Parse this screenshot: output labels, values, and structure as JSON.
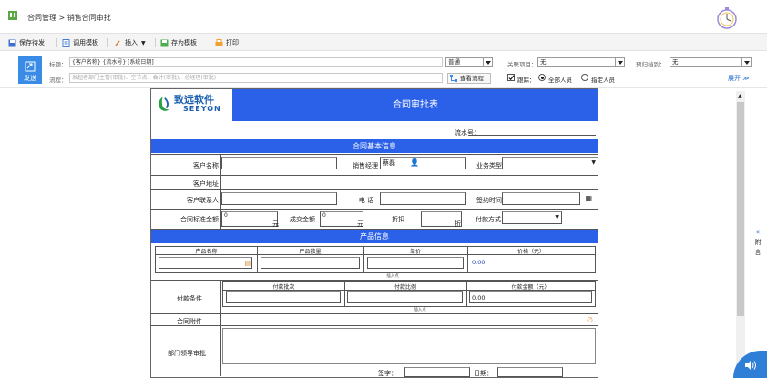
{
  "breadcrumb": "合同管理 > 销售合同审批",
  "toolbar": {
    "save_draft": "保存待发",
    "call_template": "调用模板",
    "insert": "插入",
    "save_as_template": "存为模板",
    "print": "打印"
  },
  "header": {
    "send_label": "发送",
    "subject_label": "标题：",
    "subject_value": "{客户名称} {流水号} [系统日期]",
    "importance_value": "普通",
    "related_project_label": "关联项目：",
    "related_project_value": "无",
    "archive_label": "预归档到：",
    "archive_value": "无",
    "flow_label": "流程：",
    "flow_placeholder": "发起者部门主管(审批)、空节点、会计(审批)、总经理(审批)",
    "view_flow": "查看流程",
    "trace_label": "跟踪：",
    "all_people": "全部人员",
    "specific_people": "指定人员",
    "expand": "展开"
  },
  "form": {
    "logo_cn": "致远软件",
    "logo_en": "SEEYON",
    "title": "合同审批表",
    "serial_label": "流水号：",
    "section_basic": "合同基本信息",
    "customer_name": "客户名称",
    "sales_manager": "销售经理",
    "sales_manager_value": "蔡磊",
    "business_type": "业务类型",
    "customer_address": "客户地址",
    "customer_contact": "客户联系人",
    "phone": "电 话",
    "sign_time": "签约时间",
    "standard_amount": "合同标准金额",
    "standard_amount_value": "0",
    "yuan1": "元",
    "deal_amount": "成交金额",
    "deal_amount_value": "0",
    "yuan2": "元",
    "discount": "折扣",
    "zhe": "折",
    "payment_method": "付款方式",
    "section_product": "产品信息",
    "product_cols": [
      "产品名称",
      "产品数量",
      "单价",
      "价格（元）"
    ],
    "product_price_value": "0.00",
    "insert_row1": "插入点",
    "payment_terms": "付款条件",
    "payment_cols": [
      "付款批次",
      "付款比例",
      "付款金额（元）"
    ],
    "payment_amount_value": "0.00",
    "insert_row2": "插入点",
    "contract_attachment": "合同附件",
    "dept_leader_approval": "部门领导审批",
    "sign_label": "签字：",
    "date_label": "日期："
  },
  "side": {
    "attach_chars": [
      "«",
      "附",
      "言"
    ]
  },
  "colors": {
    "accent_blue": "#2b60e8",
    "send_blue": "#3a8be6"
  }
}
